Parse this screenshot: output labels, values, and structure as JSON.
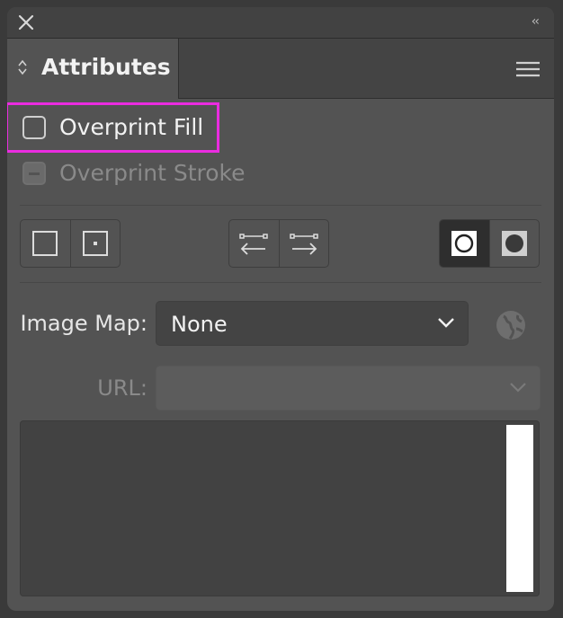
{
  "panel": {
    "title": "Attributes"
  },
  "checkboxes": {
    "overprint_fill": {
      "label": "Overprint Fill",
      "checked": false
    },
    "overprint_stroke": {
      "label": "Overprint Stroke",
      "state": "disabled-mixed"
    }
  },
  "buttons": {
    "center_group": [
      "dont-show-center-icon",
      "show-center-icon"
    ],
    "direction_group": [
      "reverse-path-direction-off-icon",
      "reverse-path-direction-on-icon"
    ],
    "fill_rule_group": [
      "nonzero-winding-fill-rule-icon",
      "even-odd-fill-rule-icon"
    ],
    "fill_rule_active": 0
  },
  "image_map": {
    "label": "Image Map:",
    "value": "None"
  },
  "url": {
    "label": "URL:",
    "value": ""
  },
  "colors": {
    "highlight": "#ea2ce0",
    "panel_bg": "#535353"
  }
}
